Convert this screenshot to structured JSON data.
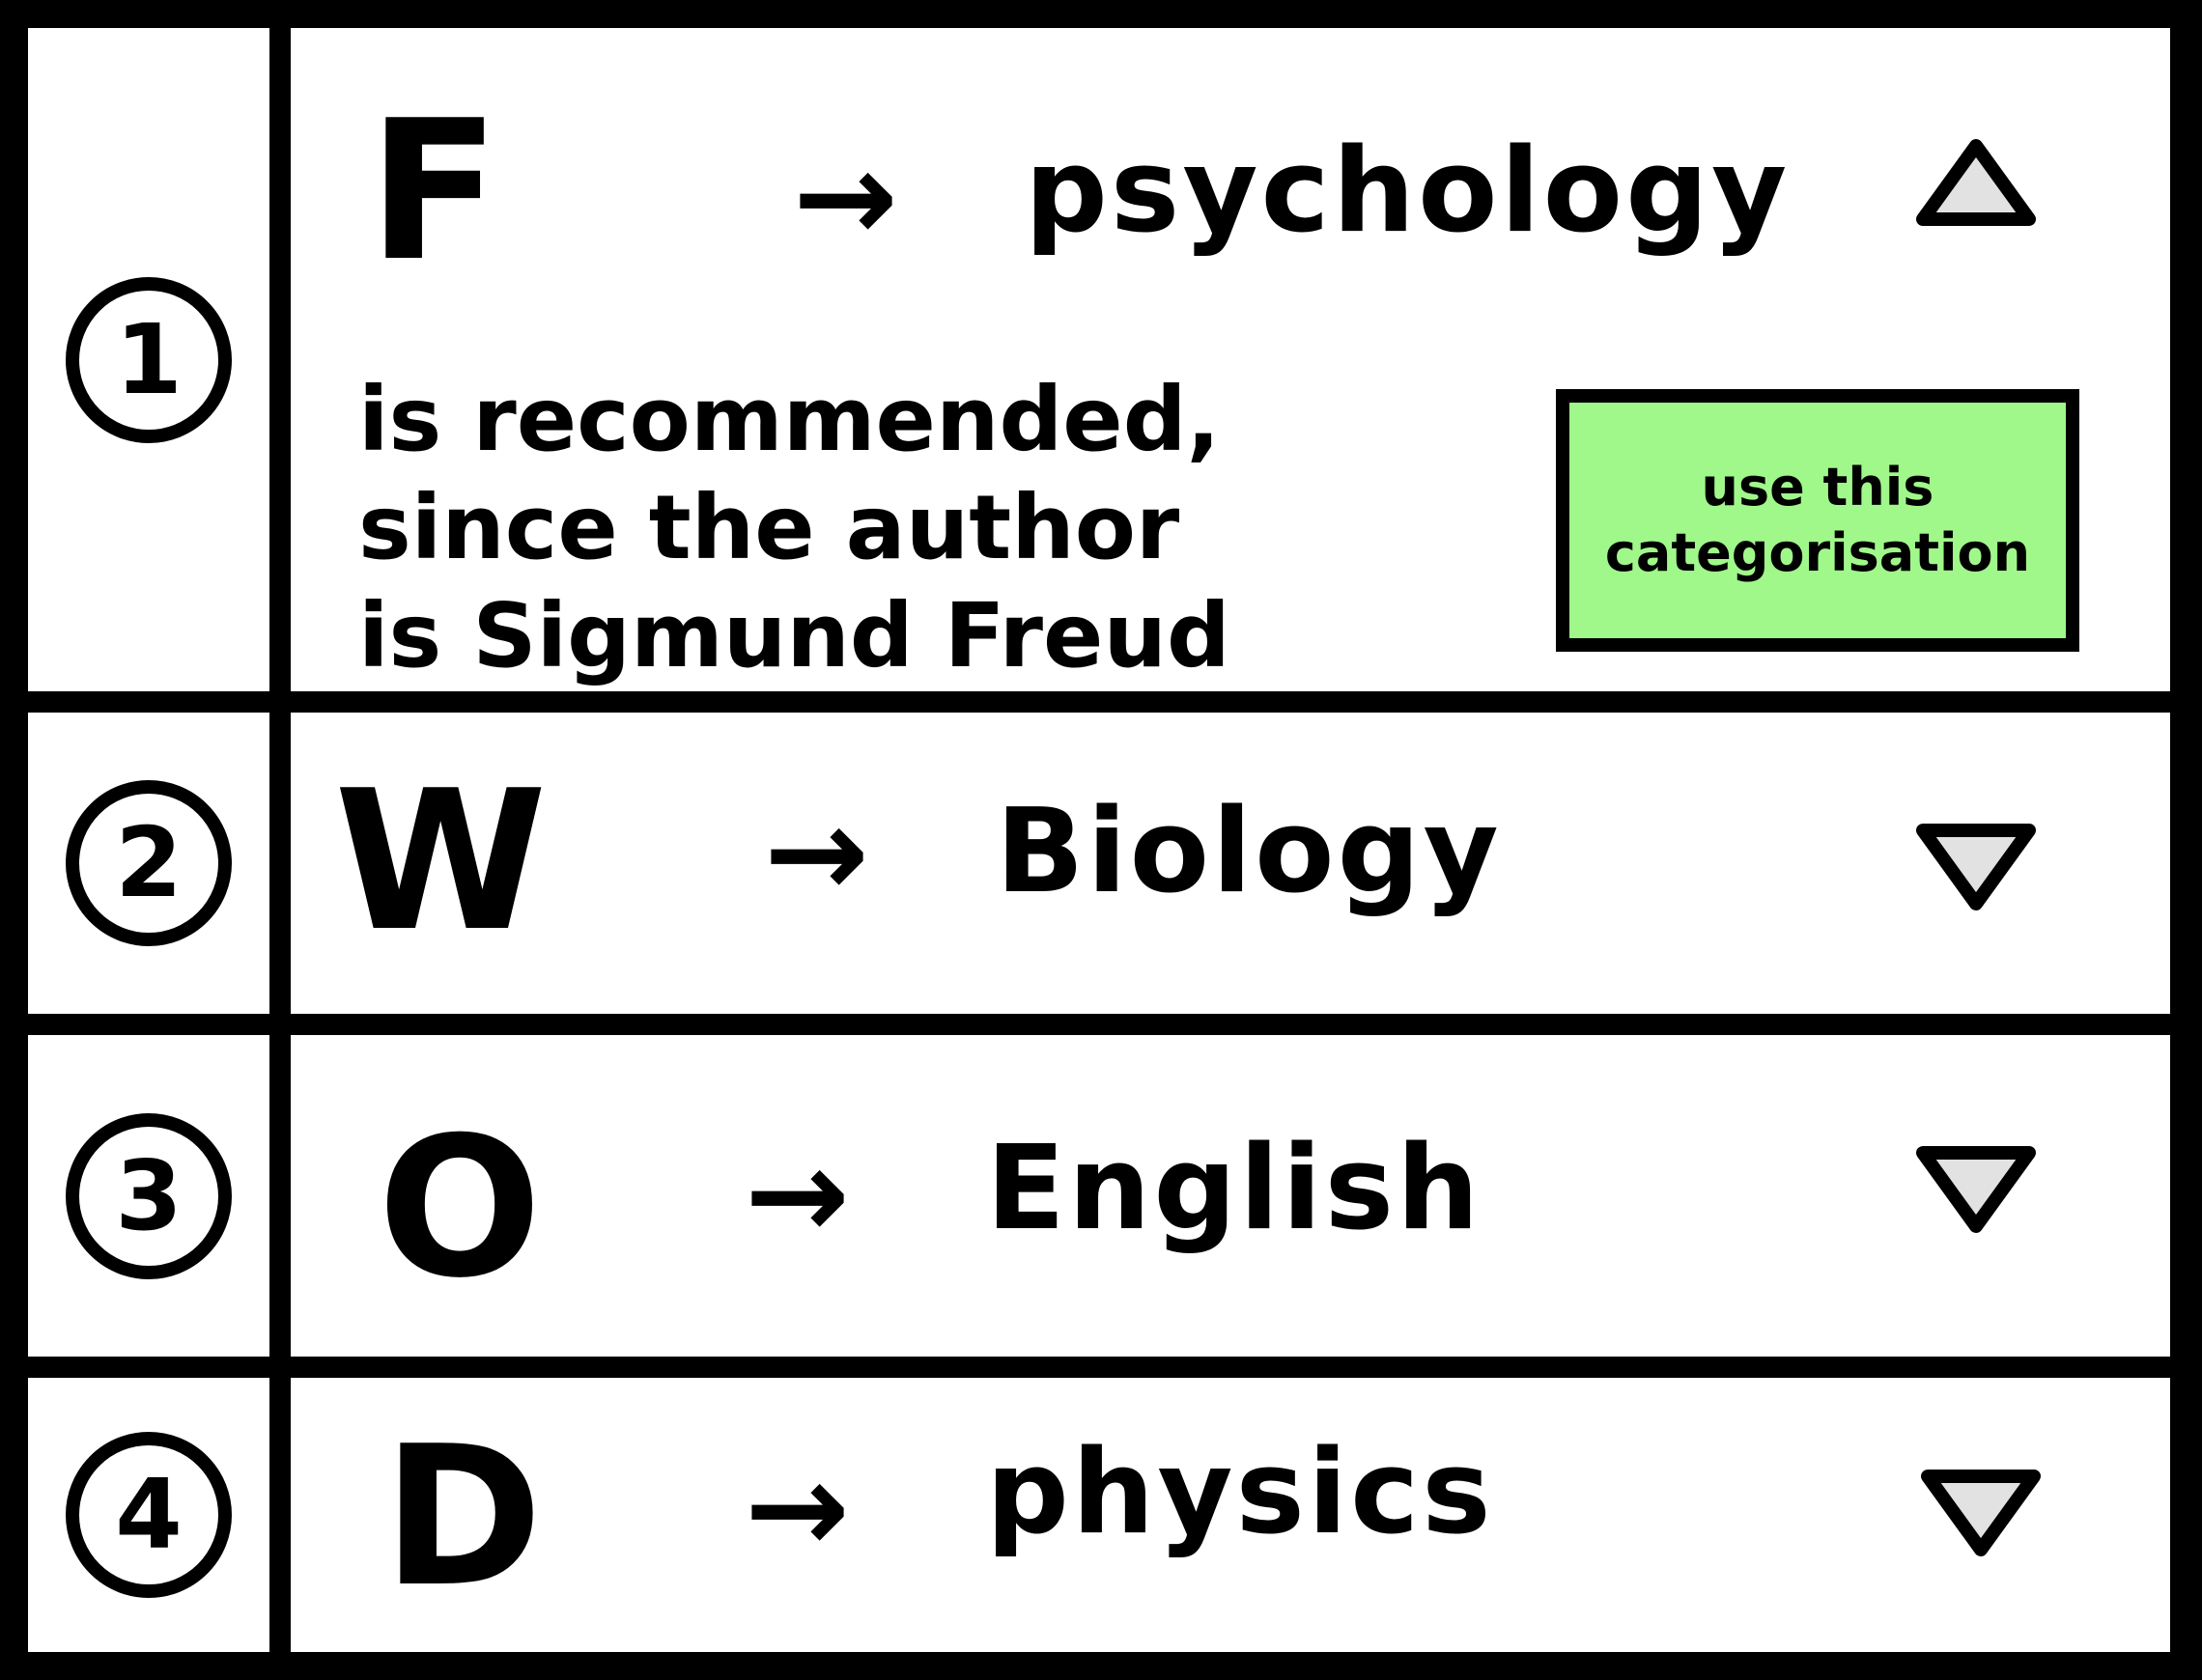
{
  "rows": [
    {
      "number": "1",
      "letter": "F",
      "arrow": "→",
      "subject": "psychology",
      "expanded": true,
      "toggle_icon": "triangle-up-icon",
      "reason_lines": [
        "is recommended,",
        "since the author",
        "is Sigmund Freud"
      ],
      "action_lines": [
        "use this",
        "categorisation"
      ]
    },
    {
      "number": "2",
      "letter": "W",
      "arrow": "→",
      "subject": "Biology",
      "expanded": false,
      "toggle_icon": "triangle-down-icon"
    },
    {
      "number": "3",
      "letter": "O",
      "arrow": "→",
      "subject": "English",
      "expanded": false,
      "toggle_icon": "triangle-down-icon"
    },
    {
      "number": "4",
      "letter": "D",
      "arrow": "→",
      "subject": "physics",
      "expanded": false,
      "toggle_icon": "triangle-down-icon"
    }
  ],
  "colors": {
    "accept_button_bg": "#a0f88a",
    "toggle_fill": "#e2e2e2",
    "border": "#000000"
  }
}
